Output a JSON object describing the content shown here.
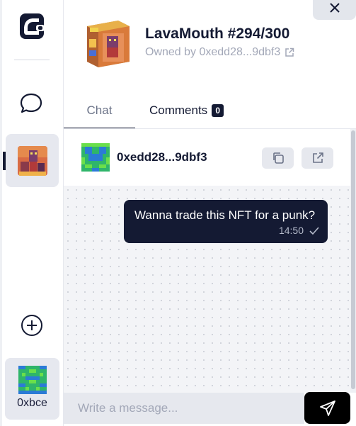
{
  "header": {
    "nft_title": "LavaMouth #294/300",
    "owner_text": "Owned by 0xedd28...9dbf3"
  },
  "tabs": [
    {
      "label": "Chat",
      "active": true
    },
    {
      "label": "Comments",
      "badge": "0"
    }
  ],
  "conversation": {
    "peer_address": "0xedd28...9dbf3"
  },
  "messages": [
    {
      "text": "Wanna trade this NFT for a punk?",
      "time": "14:50",
      "status": "check-icon",
      "from_me": true
    }
  ],
  "composer": {
    "placeholder": "Write a message..."
  },
  "sidebar": {
    "user_label": "0xbce"
  },
  "colors": {
    "accent": "#141a33",
    "muted_text": "#a3a8b8",
    "surface": "#e6e8ee",
    "chat_background": "#f3f4f7",
    "send_button": "#000000"
  },
  "icons": {
    "logo": "wallet-chat-logo",
    "chat": "speech-bubble-icon",
    "add": "plus-circle-icon",
    "close": "close-icon",
    "external": "external-link-icon",
    "copy": "copy-icon",
    "send": "send-icon"
  }
}
